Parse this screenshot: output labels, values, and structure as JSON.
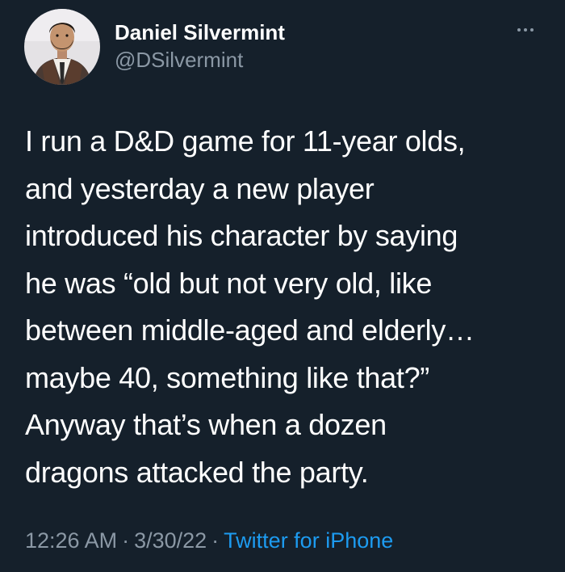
{
  "author": {
    "display_name": "Daniel Silvermint",
    "handle": "@DSilvermint"
  },
  "tweet": {
    "lines": [
      "I run a D&D game for 11-year olds,",
      "and yesterday a new player",
      "introduced his character by saying",
      "he was “old but not very old, like",
      "between middle-aged and elderly…",
      "maybe 40, something like that?”",
      "Anyway that’s when a dozen",
      "dragons attacked the party."
    ]
  },
  "meta": {
    "time": "12:26 AM",
    "separator": "·",
    "date": "3/30/22",
    "source": "Twitter for iPhone"
  },
  "icons": {
    "more": "more-options-icon",
    "avatar": "avatar"
  },
  "colors": {
    "background": "#15202b",
    "primary_text": "#ffffff",
    "secondary_text": "#8b98a5",
    "link": "#1d9bf0"
  }
}
